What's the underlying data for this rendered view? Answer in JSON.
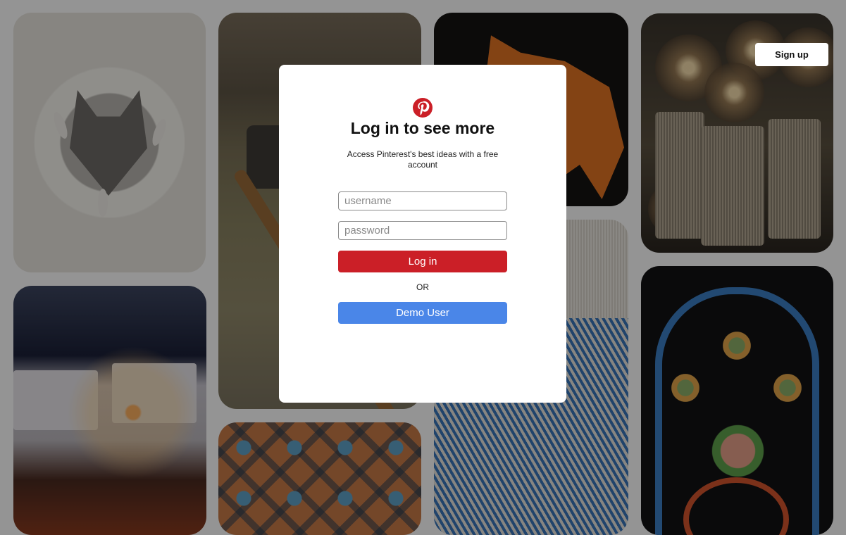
{
  "header": {
    "signup_label": "Sign up"
  },
  "modal": {
    "title": "Log in to see more",
    "subtitle": "Access Pinterest's best ideas with a free account",
    "username_placeholder": "username",
    "password_placeholder": "password",
    "login_label": "Log in",
    "or_label": "OR",
    "demo_label": "Demo User"
  },
  "colors": {
    "brand_red": "#cb1f27",
    "demo_blue": "#4a86e8"
  },
  "pins": [
    {
      "name": "paper-cut-fox"
    },
    {
      "name": "sparkler-night-scene"
    },
    {
      "name": "axe-in-stump"
    },
    {
      "name": "celtic-pattern"
    },
    {
      "name": "orange-papercut-fox"
    },
    {
      "name": "blue-woven-fabric"
    },
    {
      "name": "twine-light-balls"
    },
    {
      "name": "painted-ornament"
    }
  ]
}
